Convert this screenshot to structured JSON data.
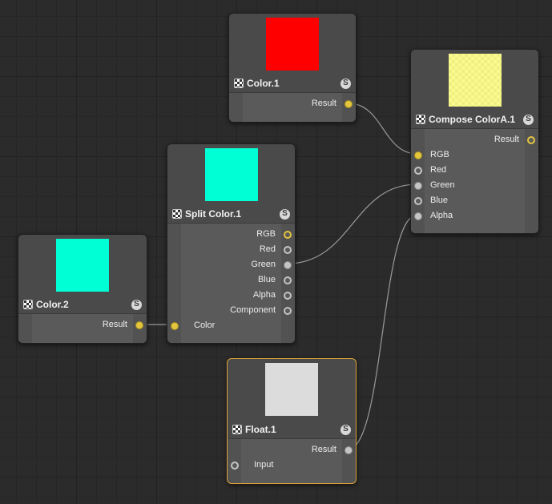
{
  "nodes": {
    "color1": {
      "title": "Color.1",
      "swatch_color": "#ff0000",
      "outputs": [
        {
          "label": "Result",
          "port_color": "yellow"
        }
      ]
    },
    "compose": {
      "title": "Compose ColorA.1",
      "swatch_color": "#fbfa8f",
      "outputs": [
        {
          "label": "Result",
          "port_color": "yellow-ring"
        }
      ],
      "inputs": [
        {
          "label": "RGB",
          "port_color": "yellow"
        },
        {
          "label": "Red",
          "port_color": "gray-ring"
        },
        {
          "label": "Green",
          "port_color": "gray"
        },
        {
          "label": "Blue",
          "port_color": "gray-ring"
        },
        {
          "label": "Alpha",
          "port_color": "gray"
        }
      ]
    },
    "split": {
      "title": "Split Color.1",
      "swatch_color": "#00ffd5",
      "outputs": [
        {
          "label": "RGB",
          "port_color": "yellow-ring"
        },
        {
          "label": "Red",
          "port_color": "gray-ring"
        },
        {
          "label": "Green",
          "port_color": "gray"
        },
        {
          "label": "Blue",
          "port_color": "gray-ring"
        },
        {
          "label": "Alpha",
          "port_color": "gray-ring"
        },
        {
          "label": "Component",
          "port_color": "gray-ring"
        }
      ],
      "inputs": [
        {
          "label": "Color",
          "port_color": "yellow"
        }
      ]
    },
    "color2": {
      "title": "Color.2",
      "swatch_color": "#00ffd5",
      "outputs": [
        {
          "label": "Result",
          "port_color": "yellow"
        }
      ]
    },
    "float1": {
      "title": "Float.1",
      "swatch_color": "#dcdcdc",
      "selected": true,
      "outputs": [
        {
          "label": "Result",
          "port_color": "gray"
        }
      ],
      "inputs": [
        {
          "label": "Input",
          "port_color": "gray-ring"
        }
      ]
    }
  },
  "icons": {
    "node_type": "checker-icon",
    "solo": "S"
  },
  "colors": {
    "canvas_bg": "#2b2b2b",
    "port_yellow": "#e3c53e",
    "port_gray": "#c4c4c4",
    "selection": "#e0a43a",
    "wire": "#9a9a9a"
  }
}
